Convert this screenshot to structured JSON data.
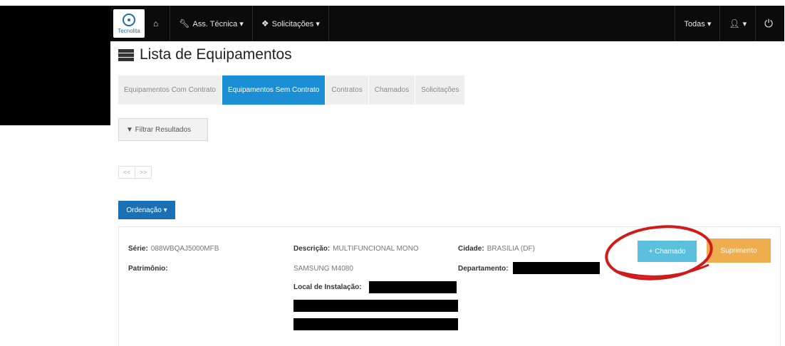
{
  "nav": {
    "logo_text": "Tecnolita",
    "home_icon": "home-icon",
    "menu": [
      {
        "icon": "wrench-icon",
        "label": "Ass. Técnica ▾"
      },
      {
        "icon": "cubes-icon",
        "label": "Solicitações ▾"
      }
    ],
    "right": [
      {
        "label": "Todas ▾"
      },
      {
        "icon": "user-icon",
        "label": "▾"
      },
      {
        "icon": "power-icon",
        "label": ""
      }
    ]
  },
  "page": {
    "title": "Lista de Equipamentos",
    "title_icon": "server-list-icon"
  },
  "tabs": [
    {
      "label": "Equipamentos Com Contrato",
      "active": false
    },
    {
      "label": "Equipamentos Sem Contrato",
      "active": true
    },
    {
      "label": "Contratos",
      "active": false
    },
    {
      "label": "Chamados",
      "active": false
    },
    {
      "label": "Solicitações",
      "active": false
    }
  ],
  "filter": {
    "label": "▼ Filtrar Resultados"
  },
  "pagination": {
    "prev": "<<",
    "next": ">>"
  },
  "order": {
    "label": "Ordenação ▾"
  },
  "equipment": {
    "serie_label": "Série:",
    "serie_value": "088WBQAJ5000MFB",
    "patrimonio_label": "Patrimônio:",
    "patrimonio_value": "",
    "descricao_label": "Descrição:",
    "descricao_value": "MULTIFUNCIONAL MONO",
    "descricao_value2": "SAMSUNG M4080",
    "local_label": "Local de Instalação:",
    "cidade_label": "Cidade:",
    "cidade_value": "BRASILIA (DF)",
    "departamento_label": "Departamento:"
  },
  "actions": {
    "chamado": "+ Chamado",
    "suprimento": "Suprimento"
  },
  "colors": {
    "navbar": "#0b0b0b",
    "tab_active": "#1a8fd6",
    "order_button": "#1b6fb5",
    "chamado_button": "#5bc0de",
    "suprimento_button": "#f0ad4e",
    "annotation_circle": "#d11a1a"
  }
}
